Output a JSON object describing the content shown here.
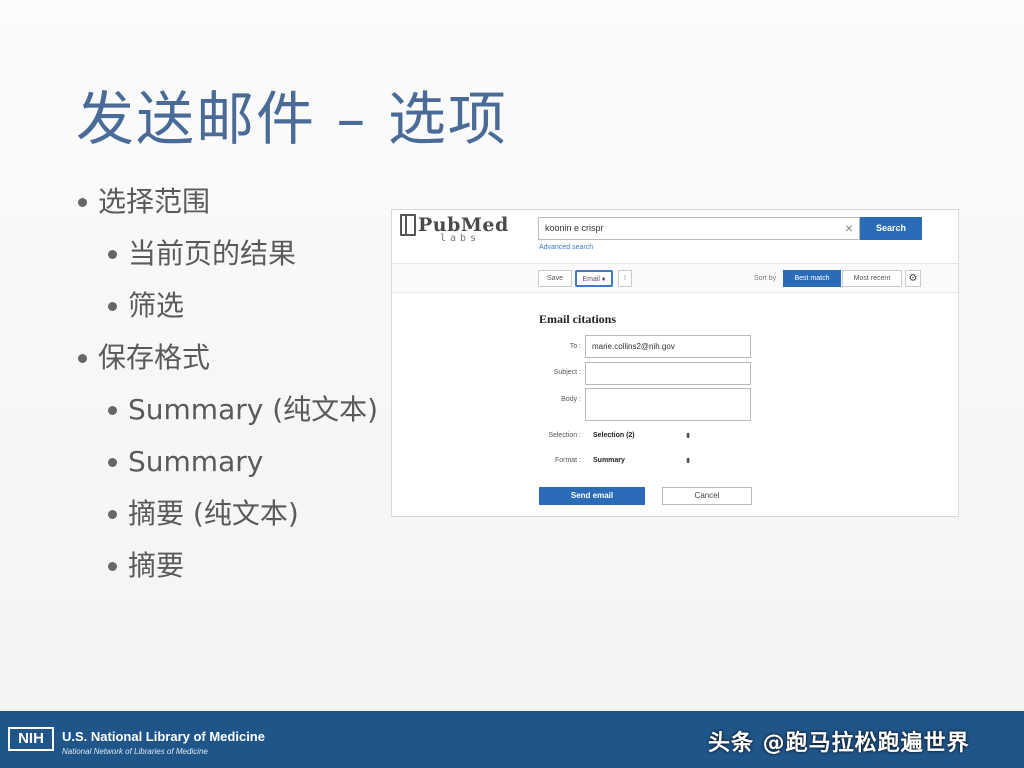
{
  "slide": {
    "title": "发送邮件 – 选项",
    "bullets": [
      {
        "text": "选择范围",
        "level": 1
      },
      {
        "text": "当前页的结果",
        "level": 2
      },
      {
        "text": "筛选",
        "level": 2
      },
      {
        "text": "保存格式",
        "level": 1
      },
      {
        "text": "Summary (纯文本)",
        "level": 2
      },
      {
        "text": "Summary",
        "level": 2
      },
      {
        "text": "摘要 (纯文本)",
        "level": 2
      },
      {
        "text": "摘要",
        "level": 2
      }
    ]
  },
  "pubmed": {
    "logo_text": "PubMed",
    "logo_sub": "labs",
    "search_value": "koonin e crispr",
    "search_button": "Search",
    "advanced_search": "Advanced search",
    "toolbar": {
      "save": "Save",
      "email": "Email ♦",
      "more": "⁝",
      "sort_label": "Sort by",
      "best_match": "Best match",
      "most_recent": "Most recent"
    },
    "form": {
      "title": "Email citations",
      "to_label": "To :",
      "to_value": "marie.collins2@nih.gov",
      "subject_label": "Subject :",
      "subject_value": "",
      "body_label": "Body :",
      "body_value": "",
      "selection_label": "Selection :",
      "selection_value": "Selection (2)",
      "format_label": "Format :",
      "format_value": "Summary",
      "send_button": "Send email",
      "cancel_button": "Cancel"
    }
  },
  "footer": {
    "nih_logo": "NIH",
    "org_name": "U.S. National Library of Medicine",
    "org_sub": "National Network of Libraries of Medicine",
    "watermark": "头条 @跑马拉松跑遍世界"
  },
  "colors": {
    "title": "#4a6a97",
    "footer_bg": "#20558a",
    "primary_button": "#2b6cb8"
  }
}
